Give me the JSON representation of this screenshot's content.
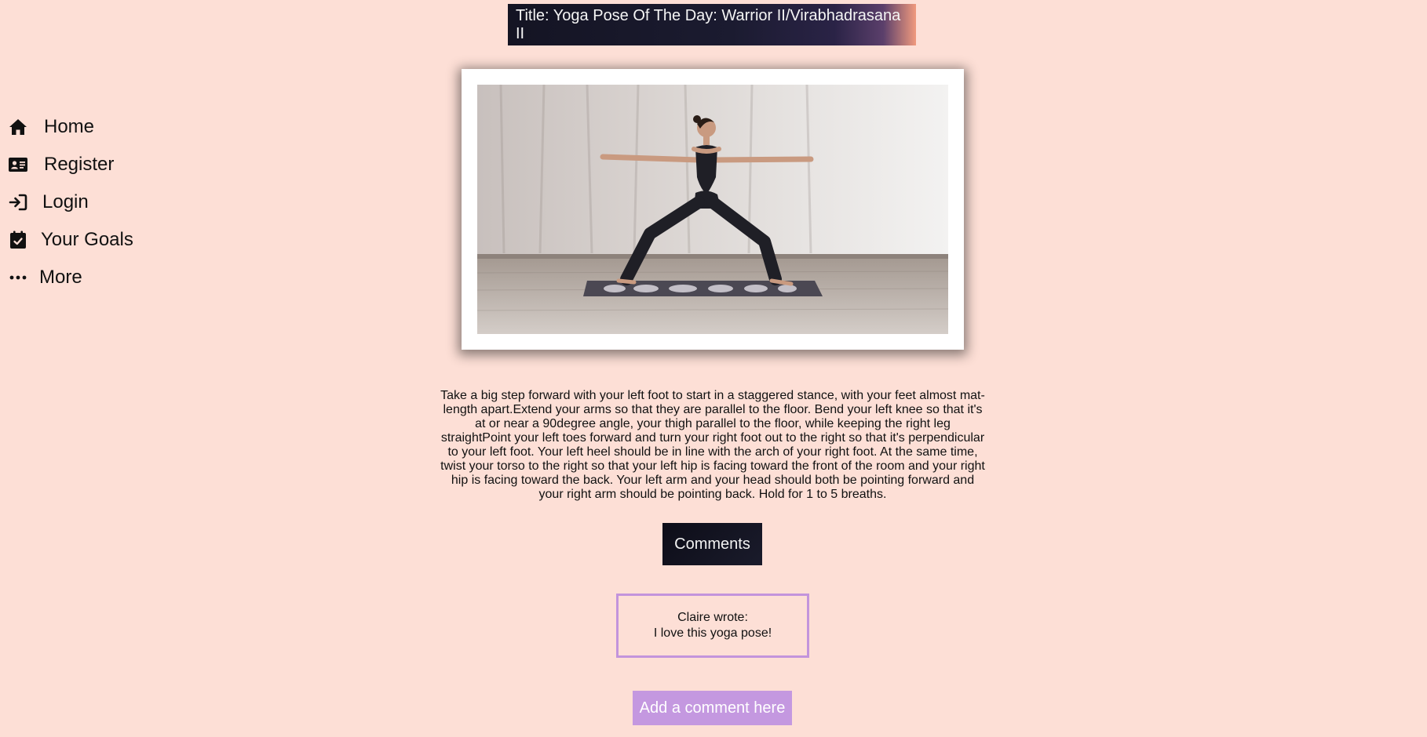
{
  "nav": {
    "items": [
      {
        "label": "Home",
        "icon": "home-icon"
      },
      {
        "label": "Register",
        "icon": "id-card-icon"
      },
      {
        "label": "Login",
        "icon": "login-icon"
      },
      {
        "label": "Your Goals",
        "icon": "calendar-check-icon"
      },
      {
        "label": "More",
        "icon": "ellipsis-icon"
      }
    ]
  },
  "header": {
    "title": "Title: Yoga Pose Of The Day: Warrior II/Virabhadrasana II"
  },
  "photo": {
    "subject": "woman-in-warrior-ii-pose-photo"
  },
  "instructions": {
    "text": "Take a big step forward with your left foot to start in a staggered stance, with your feet almost mat-length apart.Extend your arms so that they are parallel to the floor. Bend your left knee so that it's at or near a 90degree angle, your thigh parallel to the floor, while keeping the right leg straightPoint your left toes forward and turn your right foot out to the right so that it's perpendicular to your left foot. Your left heel should be in line with the arch of your right foot. At the same time, twist your torso to the right so that your left hip is facing toward the front of the room and your right hip is facing toward the back. Your left arm and your head should both be pointing forward and your right arm should be pointing back. Hold for 1 to 5 breaths."
  },
  "comments": {
    "button_label": "Comments",
    "items": [
      {
        "author_line": "Claire wrote:",
        "text": "I love this yoga pose!"
      }
    ],
    "add_label": "Add a comment here"
  },
  "colors": {
    "background": "#fddfd6",
    "accent_purple": "#c498e0",
    "dark_navy": "#141423"
  }
}
